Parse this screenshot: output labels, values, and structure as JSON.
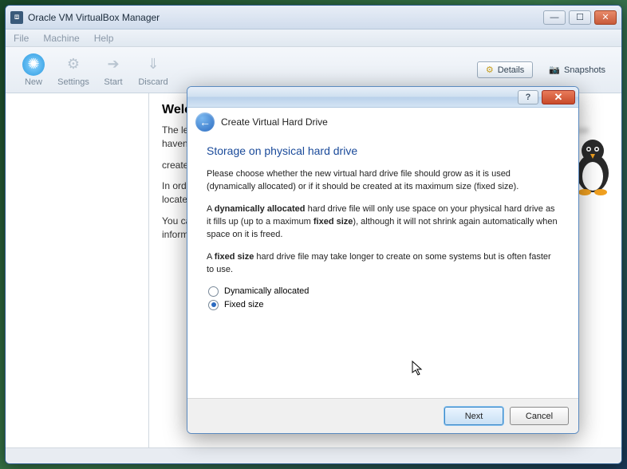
{
  "window": {
    "title": "Oracle VM VirtualBox Manager"
  },
  "menu": {
    "file": "File",
    "machine": "Machine",
    "help": "Help"
  },
  "toolbar": {
    "new": "New",
    "settings": "Settings",
    "start": "Start",
    "discard": "Discard",
    "details": "Details",
    "snapshots": "Snapshots"
  },
  "welcome": {
    "heading": "Welc",
    "p1": "The le",
    "p1b": "haven't",
    "p2": "create",
    "p3": "In orde",
    "p4": "locate",
    "p5": "You ca",
    "p6": "inform"
  },
  "dialog": {
    "header_title": "Create Virtual Hard Drive",
    "heading": "Storage on physical hard drive",
    "para1": "Please choose whether the new virtual hard drive file should grow as it is used (dynamically allocated) or if it should be created at its maximum size (fixed size).",
    "para2_a": "A ",
    "para2_b": "dynamically allocated",
    "para2_c": " hard drive file will only use space on your physical hard drive as it fills up (up to a maximum ",
    "para2_d": "fixed size",
    "para2_e": "), although it will not shrink again automatically when space on it is freed.",
    "para3_a": "A ",
    "para3_b": "fixed size",
    "para3_c": " hard drive file may take longer to create on some systems but is often faster to use.",
    "radio_dynamic": "Dynamically allocated",
    "radio_fixed": "Fixed size",
    "selected": "fixed",
    "next": "Next",
    "cancel": "Cancel"
  }
}
